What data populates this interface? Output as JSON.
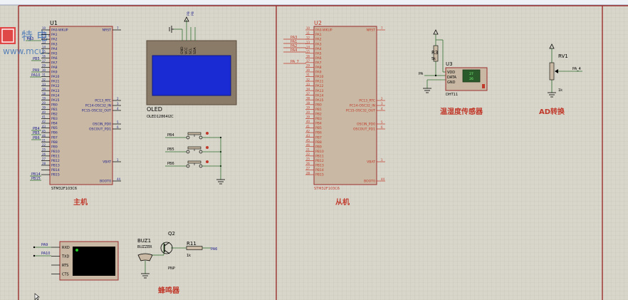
{
  "colors": {
    "grid_bg": "#d8d6ca",
    "grid_line": "#c4c2b4",
    "frame": "#9b2d2d",
    "chip_body": "#c9b9a4",
    "wire": "#2f6f2f",
    "black": "#000000",
    "pin_label_blue": "#1c1c8c",
    "red_label": "#c0392b",
    "oled_screen": "#1a2bd4",
    "oled_frame": "#8a7a68"
  },
  "watermark": {
    "brand": "特   电子",
    "url": "www.mcu   .com"
  },
  "master": {
    "ref": "U1",
    "part": "STM32F103C6",
    "section_label": "主机",
    "left_nums": [
      "10",
      "11",
      "12",
      "13",
      "14",
      "15",
      "16",
      "17",
      "29",
      "30",
      "31",
      "32",
      "33",
      "34",
      "18",
      "19",
      "20",
      "39",
      "40",
      "41",
      "42",
      "43",
      "45",
      "46",
      "21",
      "22",
      "25",
      "26",
      "27",
      "28"
    ],
    "left_pins": [
      "PA0-WKUP",
      "PA1",
      "PA2",
      "PA3",
      "PA4",
      "PA5",
      "PA6",
      "PA7",
      "PA8",
      "PA9",
      "PA10",
      "PA11",
      "PA12",
      "PA13",
      "PA14",
      "PA15",
      "PB0",
      "PB1",
      "PB2",
      "PB3",
      "PB4",
      "PB5",
      "PB6",
      "PB7",
      "PB8",
      "PB9",
      "PB10",
      "PB11",
      "PB12",
      "PB13",
      "PB14",
      "PB15"
    ],
    "right_pins": [
      {
        "num": "7",
        "name": "NRST"
      },
      {
        "num": "2",
        "name": "PC13_RTC"
      },
      {
        "num": "3",
        "name": "PC14-OSC32_IN"
      },
      {
        "num": "4",
        "name": "PC15-OSC32_OUT"
      },
      {
        "num": "5",
        "name": "OSCIN_PD0"
      },
      {
        "num": "6",
        "name": "OSCOUT_PD1"
      },
      {
        "num": "1",
        "name": "VBAT"
      },
      {
        "num": "44",
        "name": "BOOT0"
      }
    ],
    "net_labels": [
      "PA3",
      "PB5",
      "PA9",
      "PA10",
      "PB4",
      "PB5",
      "PB6",
      "PB14",
      "PB15",
      "PA8"
    ]
  },
  "slave": {
    "ref": "U2",
    "part": "STM32F103C6",
    "section_label": "从机",
    "left_nums": [
      "10",
      "11",
      "12",
      "13",
      "14",
      "15",
      "16",
      "17",
      "29",
      "30",
      "31",
      "32",
      "33",
      "34",
      "37",
      "38",
      "18",
      "19",
      "20",
      "39",
      "40",
      "41",
      "42",
      "43",
      "45",
      "46",
      "21",
      "22",
      "25",
      "26",
      "27",
      "28"
    ],
    "left_pins": [
      "PA0-WKUP",
      "PA1",
      "PA2",
      "PA3",
      "PA4",
      "PA5",
      "PA6",
      "PA7",
      "PA8",
      "PA9",
      "PA10",
      "PA11",
      "PA12",
      "PA13",
      "PA14",
      "PA15",
      "PB0",
      "PB1",
      "PB2",
      "PB3",
      "PB4",
      "PB5",
      "PB6",
      "PB7",
      "PB8",
      "PB9",
      "PB10",
      "PB11",
      "PB12",
      "PB13",
      "PB14",
      "PB15"
    ],
    "right_pins": [
      {
        "num": "7",
        "name": "NRST"
      },
      {
        "num": "2",
        "name": "PC13_RTC"
      },
      {
        "num": "3",
        "name": "PC14-OSC32_IN"
      },
      {
        "num": "4",
        "name": "PC15-OSC32_OUT"
      },
      {
        "num": "5",
        "name": "OSCIN_PD0"
      },
      {
        "num": "6",
        "name": "OSCOUT_PD1"
      },
      {
        "num": "1",
        "name": "VBAT"
      },
      {
        "num": "44",
        "name": "BOOT0"
      }
    ],
    "net_labels": [
      "PA3",
      "PA1",
      "PA2",
      "PA4",
      "PA_7"
    ]
  },
  "oled": {
    "name": "OLED",
    "part": "OLED12864I2C",
    "pins": [
      "GND",
      "VCC",
      "SCL",
      "SDA"
    ],
    "top_labels": [
      "PB",
      "PB"
    ]
  },
  "buttons": {
    "labels": [
      "PB4",
      "PB5",
      "PB6"
    ]
  },
  "terminal": {
    "pins": [
      "RXD",
      "TXD",
      "RTS",
      "CTS"
    ],
    "nets": [
      "PA9",
      "PA10"
    ]
  },
  "buzzer": {
    "ref": "BUZ1",
    "part": "BUZZER",
    "transistor_ref": "Q2",
    "transistor_type": "PNP",
    "resistor_ref": "R11",
    "resistor_val": "1k",
    "net": "PA6",
    "section_label": "蜂鸣器"
  },
  "sensor": {
    "ref": "U3",
    "resistor_ref": "R3",
    "resistor_val": "5k",
    "pins": [
      "VDD",
      "DATA",
      "GND"
    ],
    "part": "DHT11",
    "net": "PA",
    "display_top": "27",
    "display_bottom": "26",
    "section_label": "温湿度传感器"
  },
  "pot": {
    "ref": "RV1",
    "val": "1k",
    "net": "PA_4",
    "section_label": "AD转换"
  }
}
